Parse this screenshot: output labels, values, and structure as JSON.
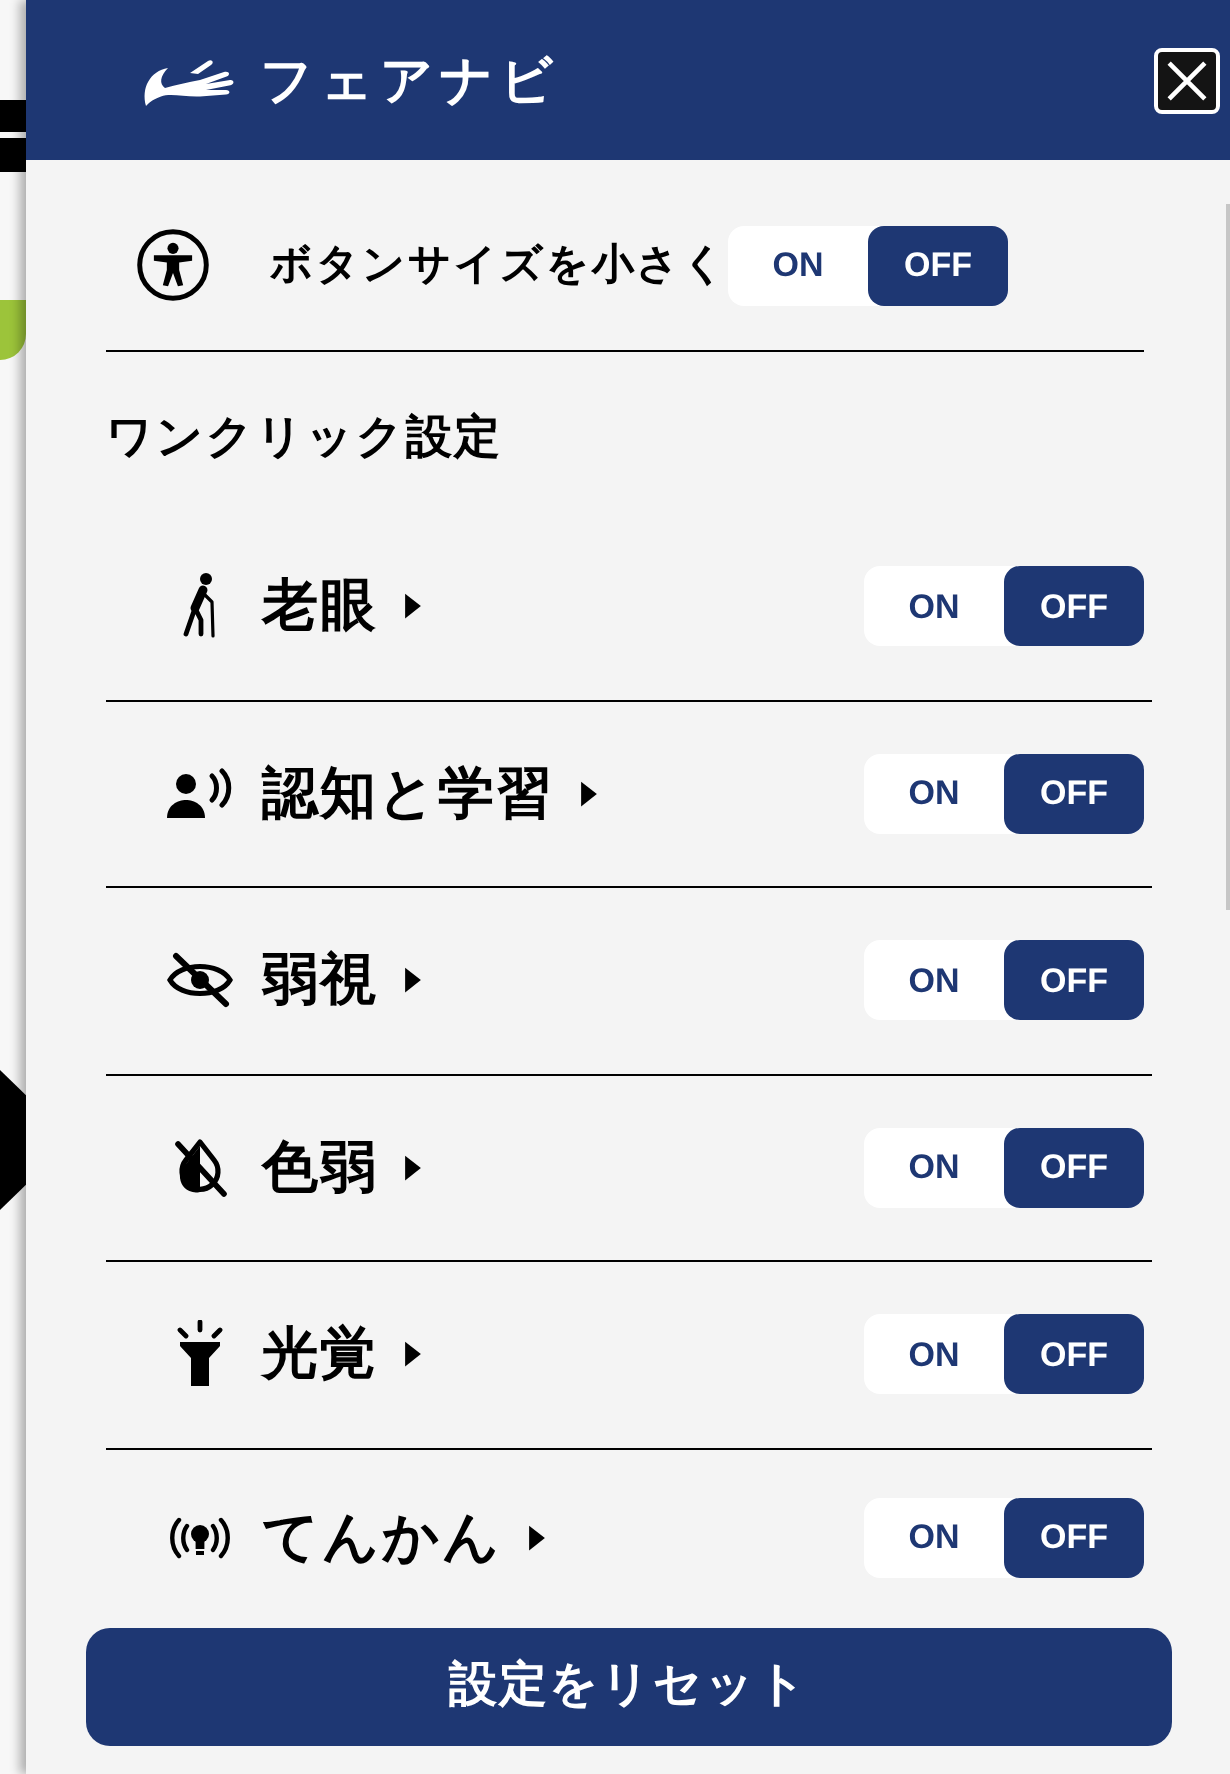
{
  "header": {
    "title": "フェアナビ"
  },
  "button_size": {
    "label": "ボタンサイズを小さく",
    "options": [
      {
        "label": "ON",
        "selected": false
      },
      {
        "label": "OFF",
        "selected": true
      }
    ]
  },
  "one_click": {
    "heading": "ワンクリック設定",
    "items": [
      {
        "label": "老眼",
        "expanded": false,
        "options": [
          {
            "label": "ON",
            "selected": false
          },
          {
            "label": "OFF",
            "selected": true
          }
        ]
      },
      {
        "label": "認知と学習",
        "expanded": false,
        "options": [
          {
            "label": "ON",
            "selected": false
          },
          {
            "label": "OFF",
            "selected": true
          }
        ]
      },
      {
        "label": "弱視",
        "expanded": false,
        "options": [
          {
            "label": "ON",
            "selected": false
          },
          {
            "label": "OFF",
            "selected": true
          }
        ]
      },
      {
        "label": "色弱",
        "expanded": false,
        "options": [
          {
            "label": "ON",
            "selected": false
          },
          {
            "label": "OFF",
            "selected": true
          }
        ]
      },
      {
        "label": "光覚",
        "expanded": false,
        "options": [
          {
            "label": "ON",
            "selected": false
          },
          {
            "label": "OFF",
            "selected": true
          }
        ]
      },
      {
        "label": "てんかん",
        "expanded": false,
        "options": [
          {
            "label": "ON",
            "selected": false
          },
          {
            "label": "OFF",
            "selected": true
          }
        ]
      }
    ]
  },
  "reset_button": {
    "label": "設定をリセット"
  }
}
